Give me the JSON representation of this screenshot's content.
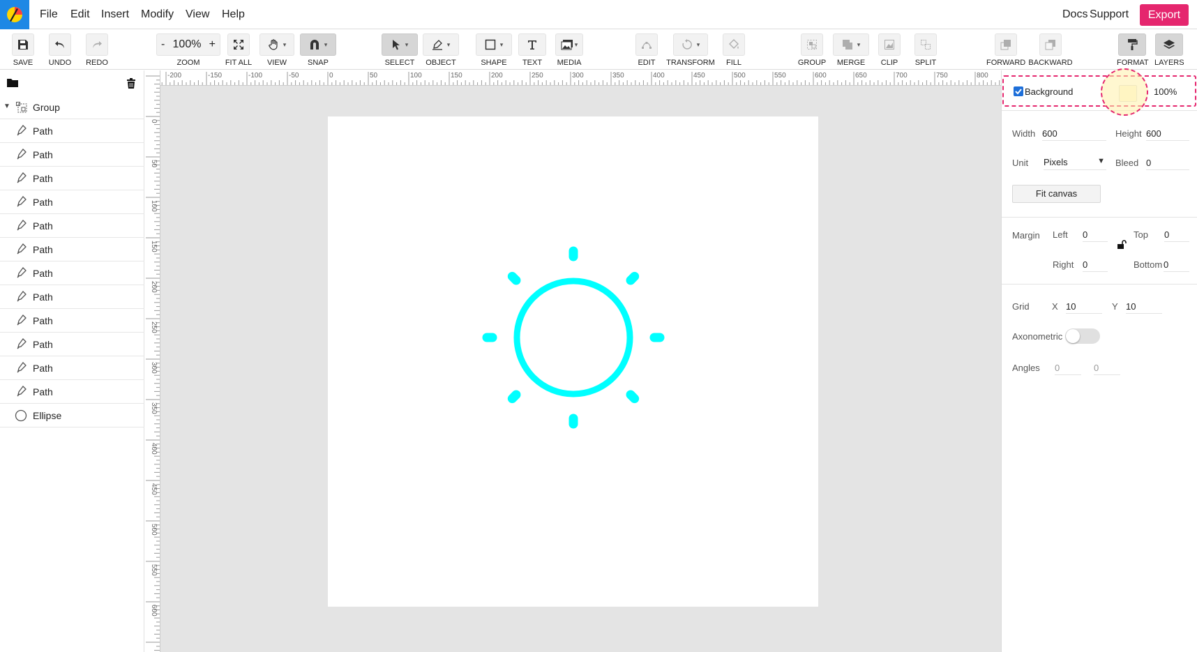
{
  "menu": {
    "items": [
      "File",
      "Edit",
      "Insert",
      "Modify",
      "View",
      "Help"
    ],
    "right": {
      "docs": "Docs",
      "support": "Support",
      "export": "Export"
    }
  },
  "toolbar": {
    "save": "SAVE",
    "undo": "UNDO",
    "redo": "REDO",
    "zoom_minus": "-",
    "zoom_value": "100%",
    "zoom_plus": "+",
    "zoom": "ZOOM",
    "fit_all": "FIT ALL",
    "view": "VIEW",
    "snap": "SNAP",
    "select": "SELECT",
    "object": "OBJECT",
    "shape": "SHAPE",
    "text": "TEXT",
    "media": "MEDIA",
    "edit": "EDIT",
    "transform": "TRANSFORM",
    "fill": "FILL",
    "group": "GROUP",
    "merge": "MERGE",
    "clip": "CLIP",
    "split": "SPLIT",
    "forward": "FORWARD",
    "backward": "BACKWARD",
    "format": "FORMAT",
    "layers": "LAYERS"
  },
  "layers": {
    "group": "Group",
    "items": [
      "Path",
      "Path",
      "Path",
      "Path",
      "Path",
      "Path",
      "Path",
      "Path",
      "Path",
      "Path",
      "Path",
      "Path"
    ],
    "ellipse": "Ellipse"
  },
  "rulers": {
    "h": [
      "-200",
      "-150",
      "-100",
      "-50",
      "0",
      "50",
      "100",
      "150",
      "200",
      "250",
      "300",
      "350",
      "400",
      "450",
      "500",
      "550",
      "600",
      "650",
      "700",
      "750",
      "800"
    ],
    "v": [
      "0",
      "50",
      "100",
      "150",
      "200",
      "250",
      "300",
      "350",
      "400",
      "450",
      "500",
      "550",
      "600"
    ]
  },
  "props": {
    "background_label": "Background",
    "background_checked": true,
    "background_color": "#fffbe0",
    "opacity": "100%",
    "width_label": "Width",
    "width": "600",
    "height_label": "Height",
    "height": "600",
    "unit_label": "Unit",
    "unit": "Pixels",
    "bleed_label": "Bleed",
    "bleed": "0",
    "fit_canvas": "Fit canvas",
    "margin_label": "Margin",
    "left_label": "Left",
    "left": "0",
    "top_label": "Top",
    "top": "0",
    "right_label": "Right",
    "right": "0",
    "bottom_label": "Bottom",
    "bottom": "0",
    "grid_label": "Grid",
    "grid_x_label": "X",
    "grid_x": "10",
    "grid_y_label": "Y",
    "grid_y": "10",
    "axonometric_label": "Axonometric",
    "axonometric_on": false,
    "angles_label": "Angles",
    "angle1": "0",
    "angle2": "0"
  },
  "colors": {
    "accent": "#e5266e",
    "sun": "#00ffff",
    "logo_bg": "#1e88e5"
  }
}
